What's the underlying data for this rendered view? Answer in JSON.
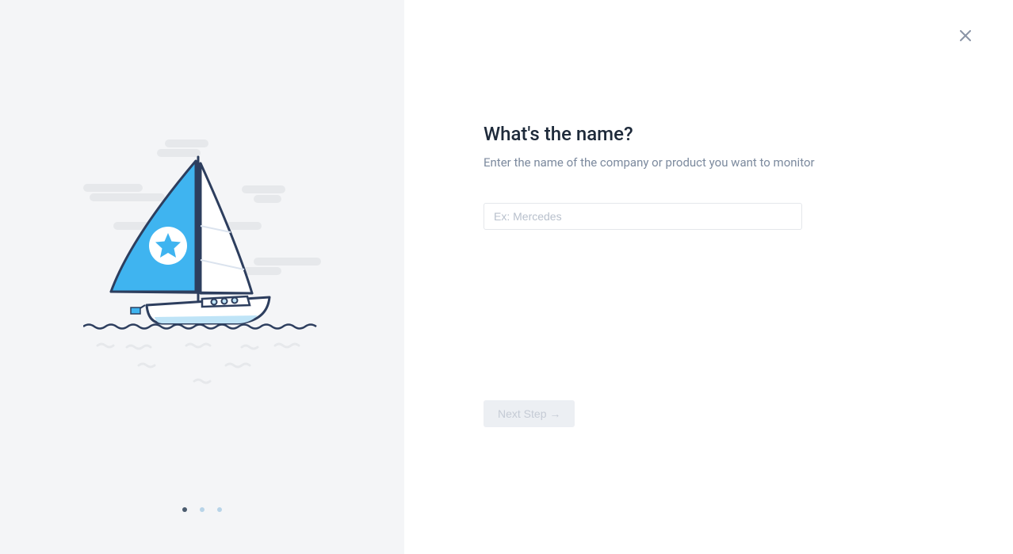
{
  "form": {
    "heading": "What's the name?",
    "subheading": "Enter the name of the company or product you want to monitor",
    "placeholder": "Ex: Mercedes",
    "value": "",
    "next_button_label": "Next Step →"
  },
  "pagination": {
    "total": 3,
    "active": 0
  },
  "illustration": {
    "name": "sailboat"
  }
}
